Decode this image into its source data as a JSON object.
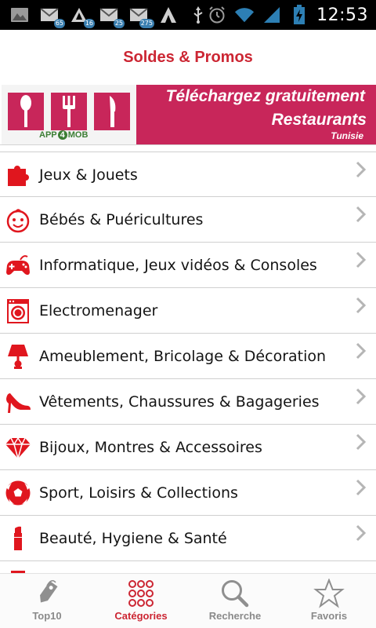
{
  "status_bar": {
    "time": "12:53",
    "notifications": [
      {
        "icon": "gallery-icon",
        "badge": ""
      },
      {
        "icon": "mail-icon",
        "badge": "65"
      },
      {
        "icon": "warning-icon",
        "badge": "16"
      },
      {
        "icon": "mail-icon",
        "badge": "25"
      },
      {
        "icon": "mail-icon",
        "badge": "275"
      },
      {
        "icon": "app-a-icon",
        "badge": ""
      },
      {
        "icon": "usb-icon",
        "badge": ""
      }
    ]
  },
  "header": {
    "title": "Soldes & Promos"
  },
  "banner": {
    "logo_text_left": "APP",
    "logo_text_mid": "4",
    "logo_text_right": "MOB",
    "line1": "Téléchargez gratuitement",
    "line2": "Restaurants",
    "line3": "Tunisie"
  },
  "categories": [
    {
      "label": "Jeux & Jouets",
      "icon": "puzzle-icon"
    },
    {
      "label": "Bébés & Puéricultures",
      "icon": "baby-icon"
    },
    {
      "label": "Informatique, Jeux vidéos & Consoles",
      "icon": "gamepad-icon"
    },
    {
      "label": "Electromenager",
      "icon": "washing-machine-icon"
    },
    {
      "label": "Ameublement, Bricolage & Décoration",
      "icon": "lamp-icon"
    },
    {
      "label": "Vêtements, Chaussures & Bagageries",
      "icon": "high-heel-icon"
    },
    {
      "label": "Bijoux, Montres & Accessoires",
      "icon": "diamond-icon"
    },
    {
      "label": "Sport, Loisirs & Collections",
      "icon": "soccer-ball-icon"
    },
    {
      "label": "Beauté, Hygiene & Santé",
      "icon": "lipstick-icon"
    },
    {
      "label": "",
      "icon": "partial-icon"
    }
  ],
  "bottom_nav": [
    {
      "label": "Top10",
      "icon": "tag-icon",
      "active": false
    },
    {
      "label": "Catégories",
      "icon": "grid-dots-icon",
      "active": true
    },
    {
      "label": "Recherche",
      "icon": "search-icon",
      "active": false
    },
    {
      "label": "Favoris",
      "icon": "star-icon",
      "active": false
    }
  ],
  "colors": {
    "accent": "#cc2633",
    "banner": "#c8265a",
    "icon_red": "#e0161e",
    "inactive": "#8a8a8a"
  }
}
